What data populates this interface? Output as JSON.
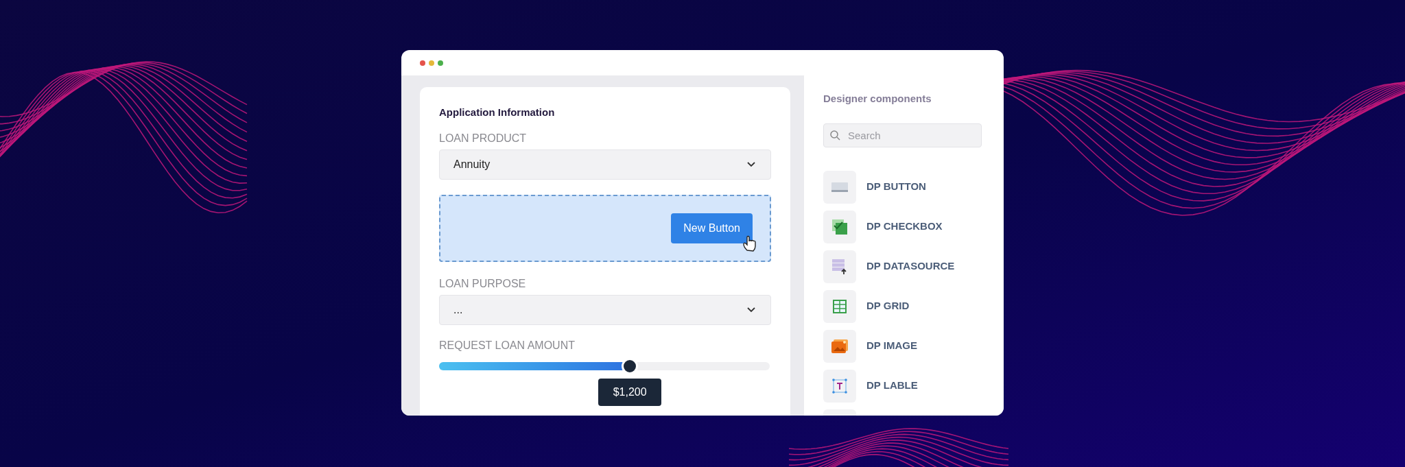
{
  "form": {
    "title": "Application Information",
    "fields": [
      {
        "kind": "select",
        "label": "LOAN PRODUCT",
        "value": "Annuity"
      },
      {
        "kind": "dropzone",
        "button": "New Button"
      },
      {
        "kind": "select",
        "label": "LOAN PURPOSE",
        "value": "..."
      },
      {
        "kind": "slider",
        "label": "REQUEST LOAN AMOUNT",
        "level": 0.577,
        "reading": "$1,200"
      }
    ]
  },
  "panel": {
    "title": "Designer components",
    "search": {
      "placeholder": "Search"
    },
    "items": [
      {
        "kind": "button",
        "label": "DP BUTTON"
      },
      {
        "kind": "checkbox",
        "label": "DP CHECKBOX"
      },
      {
        "kind": "datasource",
        "label": "DP DATASOURCE"
      },
      {
        "kind": "grid",
        "label": "DP GRID"
      },
      {
        "kind": "image",
        "label": "DP IMAGE"
      },
      {
        "kind": "label",
        "label": "DP LABLE"
      }
    ]
  }
}
